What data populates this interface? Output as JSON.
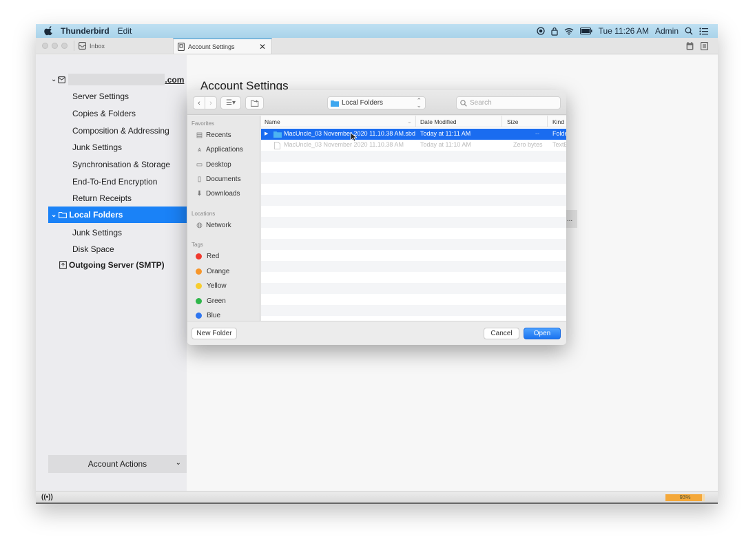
{
  "menubar": {
    "app_name": "Thunderbird",
    "menus": [
      "Edit"
    ],
    "clock": "Tue 11:26 AM",
    "user": "Admin",
    "status_icons": [
      "record-icon",
      "lock-icon",
      "wifi-icon",
      "battery-icon",
      "search-icon",
      "list-icon"
    ]
  },
  "tabs": [
    {
      "label": "Inbox",
      "icon": "inbox-icon",
      "active": false
    },
    {
      "label": "Account Settings",
      "icon": "settings-doc-icon",
      "active": true
    }
  ],
  "sidebar": {
    "account_domain": ".com",
    "account_items": [
      "Server Settings",
      "Copies & Folders",
      "Composition & Addressing",
      "Junk Settings",
      "Synchronisation & Storage",
      "End-To-End Encryption",
      "Return Receipts"
    ],
    "local_folders": {
      "label": "Local Folders",
      "items": [
        "Junk Settings",
        "Disk Space"
      ]
    },
    "outgoing": "Outgoing Server (SMTP)",
    "account_actions": "Account Actions"
  },
  "main": {
    "title": "Account Settings",
    "ghost_button": "..."
  },
  "dialog": {
    "location": "Local Folders",
    "search_placeholder": "Search",
    "favorites_header": "Favorites",
    "favorites": [
      {
        "label": "Recents",
        "icon": "recents-icon"
      },
      {
        "label": "Applications",
        "icon": "applications-icon"
      },
      {
        "label": "Desktop",
        "icon": "desktop-icon"
      },
      {
        "label": "Documents",
        "icon": "documents-icon"
      },
      {
        "label": "Downloads",
        "icon": "downloads-icon"
      }
    ],
    "locations_header": "Locations",
    "locations": [
      {
        "label": "Network",
        "icon": "network-icon"
      }
    ],
    "tags_header": "Tags",
    "tags": [
      {
        "label": "Red",
        "color": "#f03a2e"
      },
      {
        "label": "Orange",
        "color": "#f7962a"
      },
      {
        "label": "Yellow",
        "color": "#f7cd2e"
      },
      {
        "label": "Green",
        "color": "#2fb64a"
      },
      {
        "label": "Blue",
        "color": "#2f76f0"
      }
    ],
    "columns": [
      "Name",
      "Date Modified",
      "Size",
      "Kind"
    ],
    "files": [
      {
        "name": "MacUncle_03 November 2020 11.10.38 AM.sbd",
        "date": "Today at 11:11 AM",
        "size": "--",
        "kind": "Folder",
        "selected": true,
        "type": "folder"
      },
      {
        "name": "MacUncle_03 November 2020 11.10.38 AM",
        "date": "Today at 11:10 AM",
        "size": "Zero bytes",
        "kind": "TextE",
        "selected": false,
        "type": "file"
      }
    ],
    "new_folder": "New Folder",
    "cancel": "Cancel",
    "open": "Open"
  },
  "status": {
    "progress_label": "93%",
    "progress_value": 0.93
  }
}
